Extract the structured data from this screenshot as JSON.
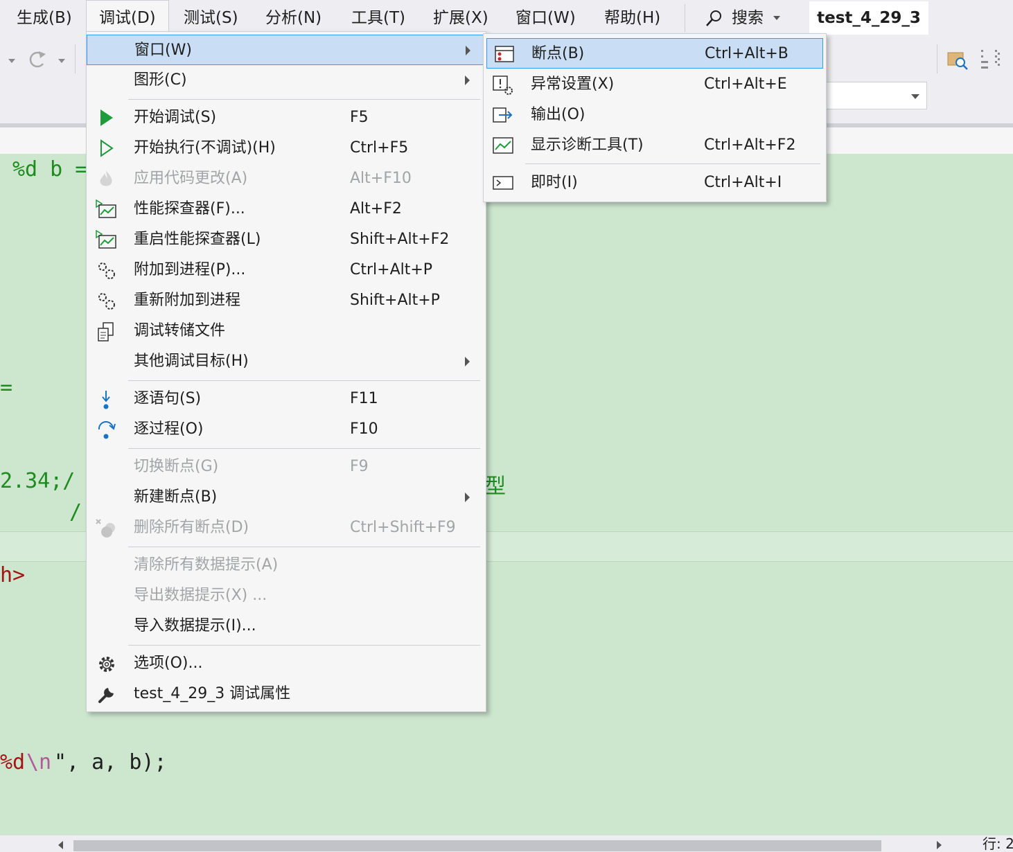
{
  "menubar": {
    "items": [
      {
        "label": "生成(B)"
      },
      {
        "label": "调试(D)"
      },
      {
        "label": "测试(S)"
      },
      {
        "label": "分析(N)"
      },
      {
        "label": "工具(T)"
      },
      {
        "label": "扩展(X)"
      },
      {
        "label": "窗口(W)"
      },
      {
        "label": "帮助(H)"
      }
    ],
    "search_label": "搜索",
    "solution_name": "test_4_29_3"
  },
  "editor": {
    "line1": "%d b =",
    "line2": "=",
    "line3": "2.34;/",
    "line3_tail": "型",
    "line4": "/",
    "line5": "h>",
    "line6a": "%d",
    "line6b": "\\n",
    "line6c": "\", a, b);"
  },
  "debug_menu": {
    "items": [
      {
        "label": "窗口(W)",
        "shortcut": "",
        "icon": "none",
        "submenu": true
      },
      {
        "label": "图形(C)",
        "shortcut": "",
        "icon": "none",
        "submenu": true
      },
      {
        "label": "开始调试(S)",
        "shortcut": "F5",
        "icon": "play-filled-icon"
      },
      {
        "label": "开始执行(不调试)(H)",
        "shortcut": "Ctrl+F5",
        "icon": "play-outline-icon"
      },
      {
        "label": "应用代码更改(A)",
        "shortcut": "Alt+F10",
        "icon": "flame-icon",
        "disabled": true
      },
      {
        "label": "性能探查器(F)...",
        "shortcut": "Alt+F2",
        "icon": "performance-chart-icon"
      },
      {
        "label": "重启性能探查器(L)",
        "shortcut": "Shift+Alt+F2",
        "icon": "performance-chart-icon"
      },
      {
        "label": "附加到进程(P)...",
        "shortcut": "Ctrl+Alt+P",
        "icon": "gears-icon"
      },
      {
        "label": "重新附加到进程",
        "shortcut": "Shift+Alt+P",
        "icon": "gears-icon"
      },
      {
        "label": "调试转储文件",
        "shortcut": "",
        "icon": "dump-file-icon"
      },
      {
        "label": "其他调试目标(H)",
        "shortcut": "",
        "icon": "none",
        "submenu": true
      },
      {
        "label": "逐语句(S)",
        "shortcut": "F11",
        "icon": "step-into-icon"
      },
      {
        "label": "逐过程(O)",
        "shortcut": "F10",
        "icon": "step-over-icon"
      },
      {
        "label": "切换断点(G)",
        "shortcut": "F9",
        "icon": "none",
        "disabled": true
      },
      {
        "label": "新建断点(B)",
        "shortcut": "",
        "icon": "none",
        "submenu": true
      },
      {
        "label": "删除所有断点(D)",
        "shortcut": "Ctrl+Shift+F9",
        "icon": "delete-breakpoints-icon",
        "disabled": true
      },
      {
        "label": "清除所有数据提示(A)",
        "shortcut": "",
        "icon": "none",
        "disabled": true
      },
      {
        "label": "导出数据提示(X) ...",
        "shortcut": "",
        "icon": "none",
        "disabled": true
      },
      {
        "label": "导入数据提示(I)...",
        "shortcut": "",
        "icon": "none"
      },
      {
        "label": "选项(O)...",
        "shortcut": "",
        "icon": "gear-icon"
      },
      {
        "label": "test_4_29_3 调试属性",
        "shortcut": "",
        "icon": "wrench-icon"
      }
    ]
  },
  "window_submenu": {
    "items": [
      {
        "label": "断点(B)",
        "shortcut": "Ctrl+Alt+B",
        "icon": "breakpoints-window-icon"
      },
      {
        "label": "异常设置(X)",
        "shortcut": "Ctrl+Alt+E",
        "icon": "exception-settings-icon"
      },
      {
        "label": "输出(O)",
        "shortcut": "",
        "icon": "output-icon"
      },
      {
        "label": "显示诊断工具(T)",
        "shortcut": "Ctrl+Alt+F2",
        "icon": "diagnostic-tools-icon"
      },
      {
        "label": "即时(I)",
        "shortcut": "Ctrl+Alt+I",
        "icon": "immediate-window-icon"
      }
    ]
  },
  "status": {
    "line_label": "行: 2"
  },
  "colors": {
    "accent": "#3399ff",
    "highlight": "#c9def5",
    "editor_bg": "#cde7cf",
    "play_green": "#1e9c3b",
    "step_blue": "#1a72c4"
  }
}
